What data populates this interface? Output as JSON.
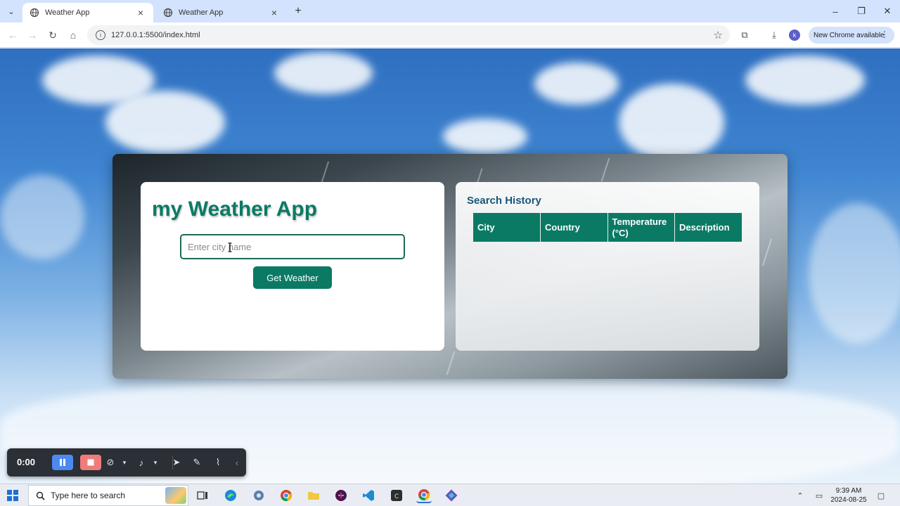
{
  "browser": {
    "tabs": [
      {
        "label": "Weather App",
        "active": true
      },
      {
        "label": "Weather App",
        "active": false
      }
    ],
    "url": "127.0.0.1:5500/index.html",
    "update_label": "New Chrome available",
    "profile_initial": "k"
  },
  "app": {
    "title": "my Weather App",
    "city_placeholder": "Enter city name",
    "button_label": "Get Weather"
  },
  "history": {
    "title": "Search History",
    "columns": [
      "City",
      "Country",
      "Temperature (°C)",
      "Description"
    ]
  },
  "recorder": {
    "time": "0:00"
  },
  "taskbar": {
    "search_placeholder": "Type here to search",
    "time": "9:39 AM",
    "date": "2024-08-25"
  },
  "colors": {
    "accent": "#0b7a65",
    "history_title": "#18567a",
    "chrome_bar": "#d3e3fd",
    "pause": "#4d8af0",
    "stop": "#f07b7b"
  }
}
